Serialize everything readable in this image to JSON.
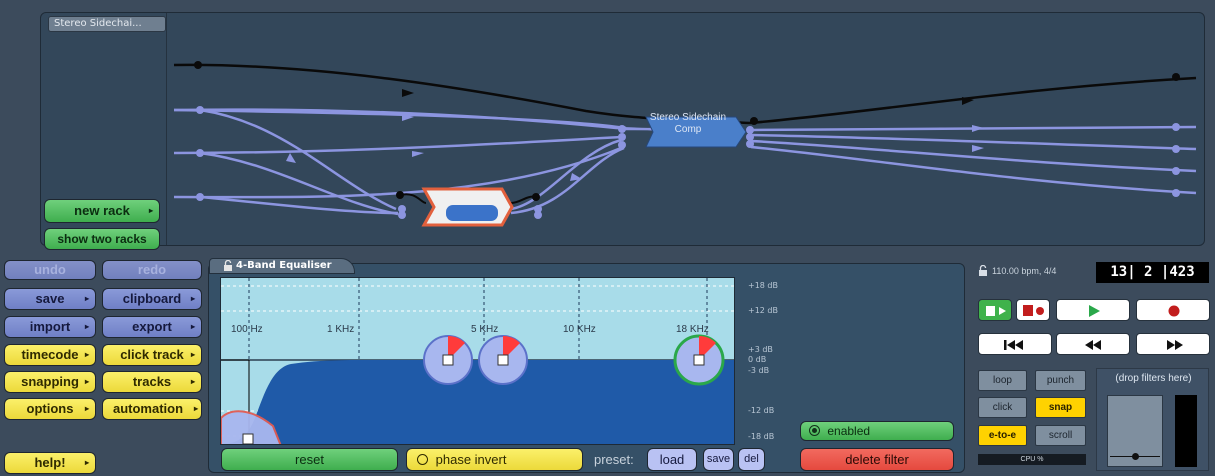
{
  "rack": {
    "label": "Stereo Sidechai...",
    "node_label_line1": "Stereo Sidechain",
    "node_label_line2": "Comp"
  },
  "left_buttons": {
    "new_rack": "new rack",
    "show_two_racks": "show two racks",
    "undo": "undo",
    "redo": "redo",
    "save": "save",
    "clipboard": "clipboard",
    "import": "import",
    "export": "export",
    "timecode": "timecode",
    "click_track": "click track",
    "snapping": "snapping",
    "tracks": "tracks",
    "options": "options",
    "automation": "automation",
    "help": "help!"
  },
  "equaliser": {
    "title": "4-Band Equaliser",
    "freq_labels": [
      "100 Hz",
      "1 KHz",
      "5 KHz",
      "10 KHz",
      "18 KHz"
    ],
    "db_labels": [
      "+18 dB",
      "+12 dB",
      "+3 dB",
      "0 dB",
      "-3 dB",
      "-12 dB",
      "-18 dB"
    ],
    "enabled_label": "enabled",
    "reset_label": "reset",
    "phase_invert_label": "phase invert",
    "preset_label": "preset:",
    "load_label": "load",
    "save_label": "save",
    "del_label": "del",
    "delete_filter_label": "delete filter"
  },
  "transport": {
    "tempo_info": "110.00 bpm, 4/4",
    "position": "13| 2 |423",
    "loop": "loop",
    "punch": "punch",
    "click": "click",
    "snap": "snap",
    "e_to_e": "e-to-e",
    "scroll": "scroll",
    "cpu": "CPU %",
    "drop_filters": "(drop filters here)"
  },
  "colors": {
    "accent_green": "#4cbc5a",
    "accent_yellow": "#f3e24a",
    "accent_blue": "#7b8bd0",
    "delete_red": "#ef5b4f",
    "graph_fill": "#1f5aa8",
    "rack_line": "#8c95e0"
  }
}
